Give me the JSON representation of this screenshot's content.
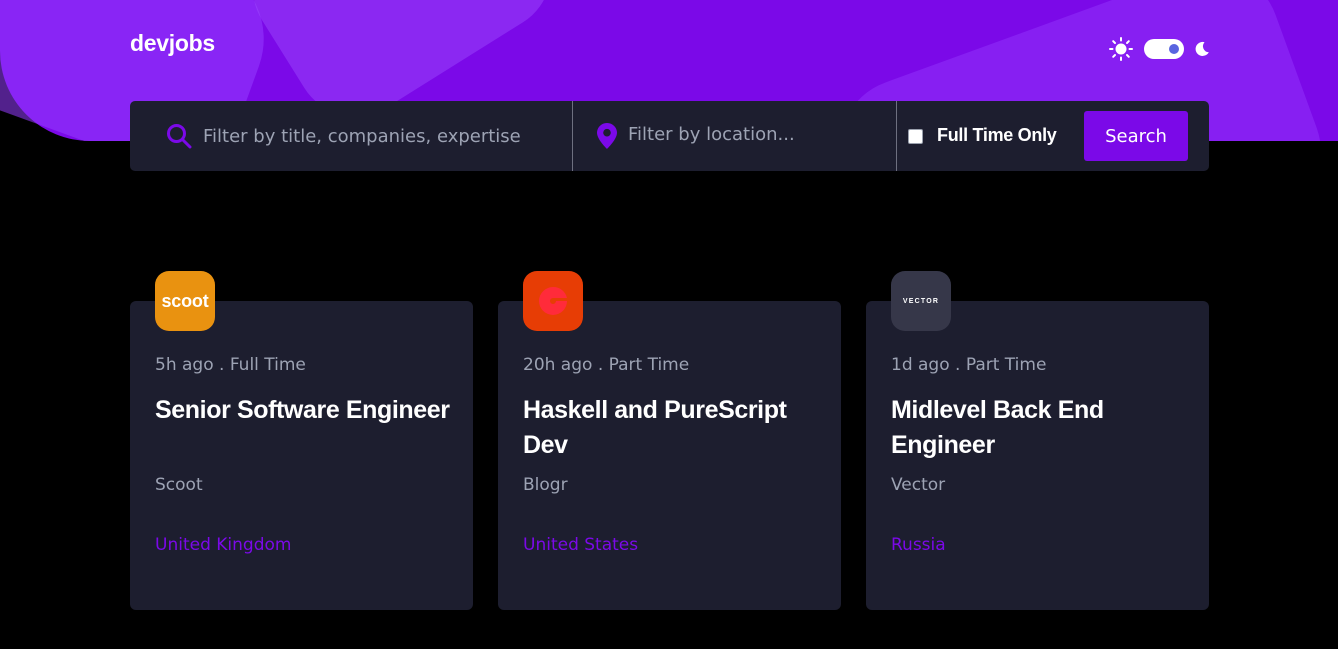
{
  "header": {
    "logo": "devjobs"
  },
  "theme": {
    "sun_icon": "sun-icon",
    "moon_icon": "moon-icon",
    "mode": "dark"
  },
  "search": {
    "title_placeholder": "Filter by title, companies, expertise",
    "location_placeholder": "Filter by location...",
    "fulltime_label": "Full Time Only",
    "fulltime_checked": false,
    "button_label": "Search"
  },
  "colors": {
    "accent": "#7b09e8",
    "card_bg": "#1d1e2f",
    "page_bg": "#000000"
  },
  "jobs": [
    {
      "logo_text": "scoot",
      "logo_color": "#e99210",
      "meta": "5h ago . Full Time",
      "title": "Senior Software Engineer",
      "company": "Scoot",
      "location": "United Kingdom"
    },
    {
      "logo_text": "",
      "logo_color": "#e73d05",
      "meta": "20h ago . Part Time",
      "title": "Haskell and PureScript Dev",
      "company": "Blogr",
      "location": "United States"
    },
    {
      "logo_text": "VECTOR",
      "logo_color": "#363749",
      "meta": "1d ago . Part Time",
      "title": "Midlevel Back End Engineer",
      "company": "Vector",
      "location": "Russia"
    }
  ]
}
